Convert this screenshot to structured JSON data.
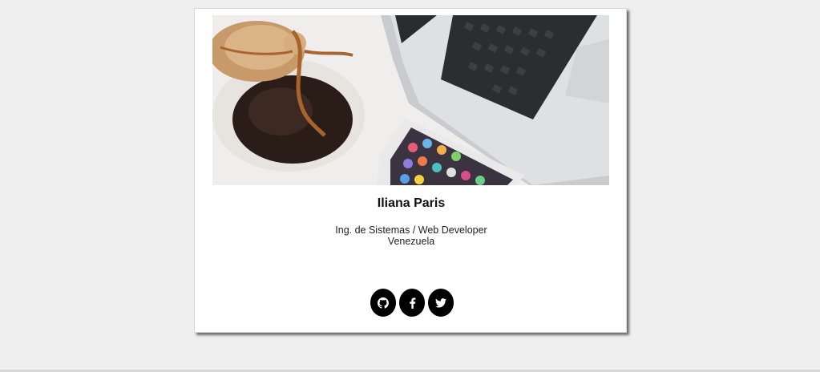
{
  "profile": {
    "name": "Iliana Paris",
    "title": "Ing. de Sistemas / Web Developer",
    "location": "Venezuela"
  },
  "photo": {
    "description_icon": "desk-photo"
  },
  "socials": [
    {
      "icon": "github-icon"
    },
    {
      "icon": "facebook-icon"
    },
    {
      "icon": "twitter-icon"
    }
  ],
  "colors": {
    "background": "#efefef",
    "card": "#ffffff",
    "social_button": "#000000",
    "text": "#111111"
  }
}
